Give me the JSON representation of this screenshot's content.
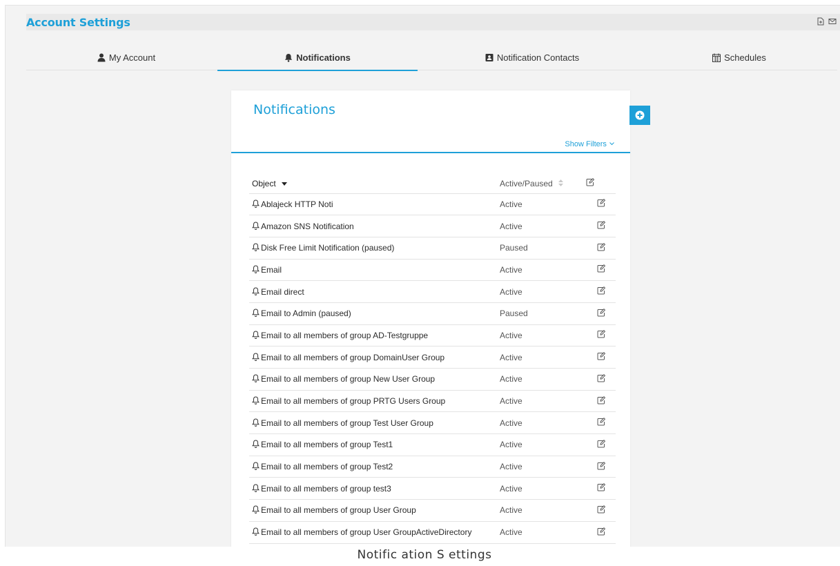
{
  "header": {
    "title": "Account Settings"
  },
  "tabs": [
    {
      "label": "My Account",
      "icon": "user-icon"
    },
    {
      "label": "Notifications",
      "icon": "bell-icon"
    },
    {
      "label": "Notification Contacts",
      "icon": "contact-card-icon"
    },
    {
      "label": "Schedules",
      "icon": "calendar-icon"
    }
  ],
  "active_tab": "Notifications",
  "panel": {
    "title": "Notifications",
    "show_filters": "Show Filters"
  },
  "table": {
    "columns": [
      "Object",
      "Active/Paused"
    ],
    "rows": [
      {
        "object": "Ablajeck HTTP Noti",
        "status": "Active"
      },
      {
        "object": "Amazon SNS Notification",
        "status": "Active"
      },
      {
        "object": "Disk Free Limit Notification (paused)",
        "status": "Paused"
      },
      {
        "object": "Email",
        "status": "Active"
      },
      {
        "object": "Email direct",
        "status": "Active"
      },
      {
        "object": "Email to Admin (paused)",
        "status": "Paused"
      },
      {
        "object": "Email to all members of group AD-Testgruppe",
        "status": "Active"
      },
      {
        "object": "Email to all members of group DomainUser Group",
        "status": "Active"
      },
      {
        "object": "Email to all members of group New User Group",
        "status": "Active"
      },
      {
        "object": "Email to all members of group PRTG Users Group",
        "status": "Active"
      },
      {
        "object": "Email to all members of group Test User Group",
        "status": "Active"
      },
      {
        "object": "Email to all members of group Test1",
        "status": "Active"
      },
      {
        "object": "Email to all members of group Test2",
        "status": "Active"
      },
      {
        "object": "Email to all members of group test3",
        "status": "Active"
      },
      {
        "object": "Email to all members of group User Group",
        "status": "Active"
      },
      {
        "object": "Email to all members of group User GroupActiveDirectory",
        "status": "Active"
      }
    ]
  },
  "caption": "Notific ation S ettings",
  "colors": {
    "accent": "#1ea0d8",
    "background": "#f3f3f3"
  }
}
